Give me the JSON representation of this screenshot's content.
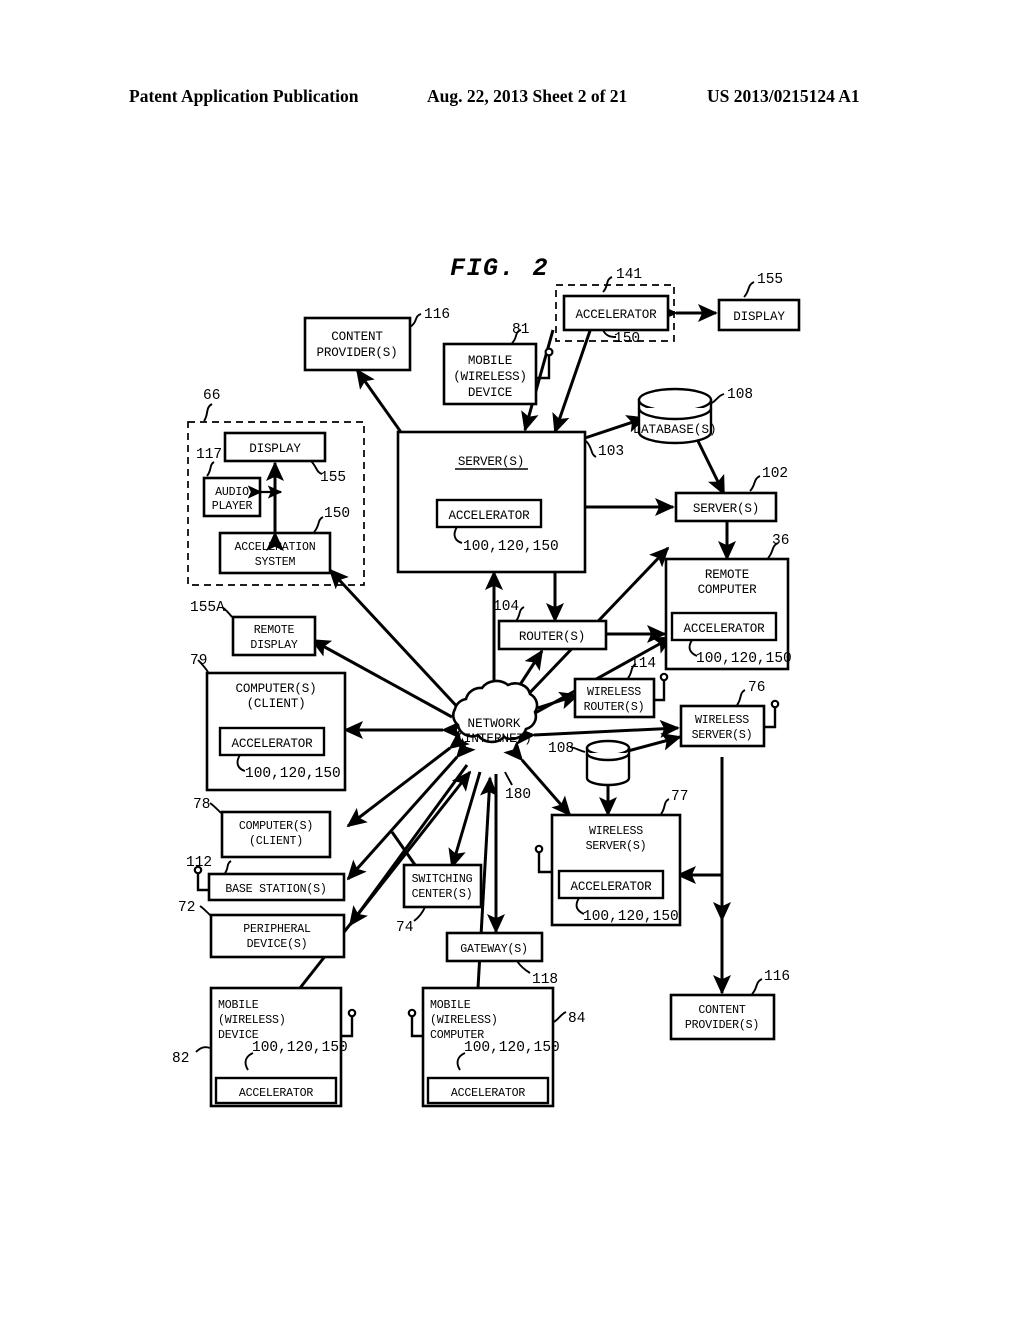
{
  "header": {
    "publication": "Patent Application Publication",
    "date_sheet": "Aug. 22, 2013  Sheet 2 of 21",
    "patent_number": "US 2013/0215124 A1"
  },
  "figure": {
    "title": "FIG. 2"
  },
  "accelerator_label": "ACCELERATOR",
  "accel_refs": "100,120,150",
  "nodes": {
    "group66": {
      "ref": "66"
    },
    "group141": {
      "ref": "141"
    },
    "content_provider_top": {
      "line1": "CONTENT",
      "line2": "PROVIDER(S)",
      "ref": "116"
    },
    "mobile_device_81": {
      "line1": "MOBILE",
      "line2": "(WIRELESS)",
      "line3": "DEVICE",
      "ref": "81"
    },
    "accelerator_141": {
      "label": "ACCELERATOR",
      "ref": "150"
    },
    "display_155_top": {
      "label": "DISPLAY",
      "ref": "155"
    },
    "display_155_left": {
      "label": "DISPLAY",
      "ref": "155"
    },
    "audio_player_117": {
      "line1": "AUDIO",
      "line2": "PLAYER",
      "ref": "117"
    },
    "acceleration_system_150": {
      "line1": "ACCELERATION",
      "line2": "SYSTEM",
      "ref": "150"
    },
    "servers_main": {
      "label": "SERVER(S)",
      "ref": "103",
      "accel": "ACCELERATOR",
      "accel_ref": "100,120,150"
    },
    "database_108": {
      "label": "DATABASE(S)",
      "ref": "108"
    },
    "servers_102": {
      "label": "SERVER(S)",
      "ref": "102"
    },
    "remote_computer_36": {
      "line1": "REMOTE",
      "line2": "COMPUTER",
      "ref": "36",
      "accel": "ACCELERATOR",
      "accel_ref": "100,120,150"
    },
    "remote_display_155a": {
      "line1": "REMOTE",
      "line2": "DISPLAY",
      "ref": "155A"
    },
    "computers_client_79": {
      "line1": "COMPUTER(S)",
      "line2": "(CLIENT)",
      "ref": "79",
      "accel": "ACCELERATOR",
      "accel_ref": "100,120,150"
    },
    "router_104": {
      "label": "ROUTER(S)",
      "ref": "104"
    },
    "wireless_router_114": {
      "line1": "WIRELESS",
      "line2": "ROUTER(S)",
      "ref": "114"
    },
    "network_cloud_180": {
      "line1": "NETWORK",
      "line2": "(INTERNET)",
      "ref": "180"
    },
    "wireless_server_76": {
      "line1": "WIRELESS",
      "line2": "SERVER(S)",
      "ref": "76"
    },
    "database_108b": {
      "ref": "108"
    },
    "wireless_server_77": {
      "line1": "WIRELESS",
      "line2": "SERVER(S)",
      "ref": "77",
      "accel": "ACCELERATOR",
      "accel_ref": "100,120,150"
    },
    "computers_client_78": {
      "line1": "COMPUTER(S)",
      "line2": "(CLIENT)",
      "ref": "78"
    },
    "base_station_112": {
      "label": "BASE STATION(S)",
      "ref": "112"
    },
    "peripheral_device_72": {
      "line1": "PERIPHERAL",
      "line2": "DEVICE(S)",
      "ref": "72"
    },
    "switching_center_74": {
      "line1": "SWITCHING",
      "line2": "CENTER(S)",
      "ref": "74"
    },
    "gateway_118": {
      "label": "GATEWAY(S)",
      "ref": "118"
    },
    "mobile_device_82": {
      "line1": "MOBILE",
      "line2": "(WIRELESS)",
      "line3": "DEVICE",
      "ref": "82",
      "accel": "ACCELERATOR",
      "accel_ref": "100,120,150"
    },
    "mobile_computer_84": {
      "line1": "MOBILE",
      "line2": "(WIRELESS)",
      "line3": "COMPUTER",
      "ref": "84",
      "accel": "ACCELERATOR",
      "accel_ref": "100,120,150"
    },
    "content_provider_bottom": {
      "line1": "CONTENT",
      "line2": "PROVIDER(S)",
      "ref": "116"
    }
  },
  "colors": {
    "ink": "#000000",
    "paper": "#ffffff"
  }
}
